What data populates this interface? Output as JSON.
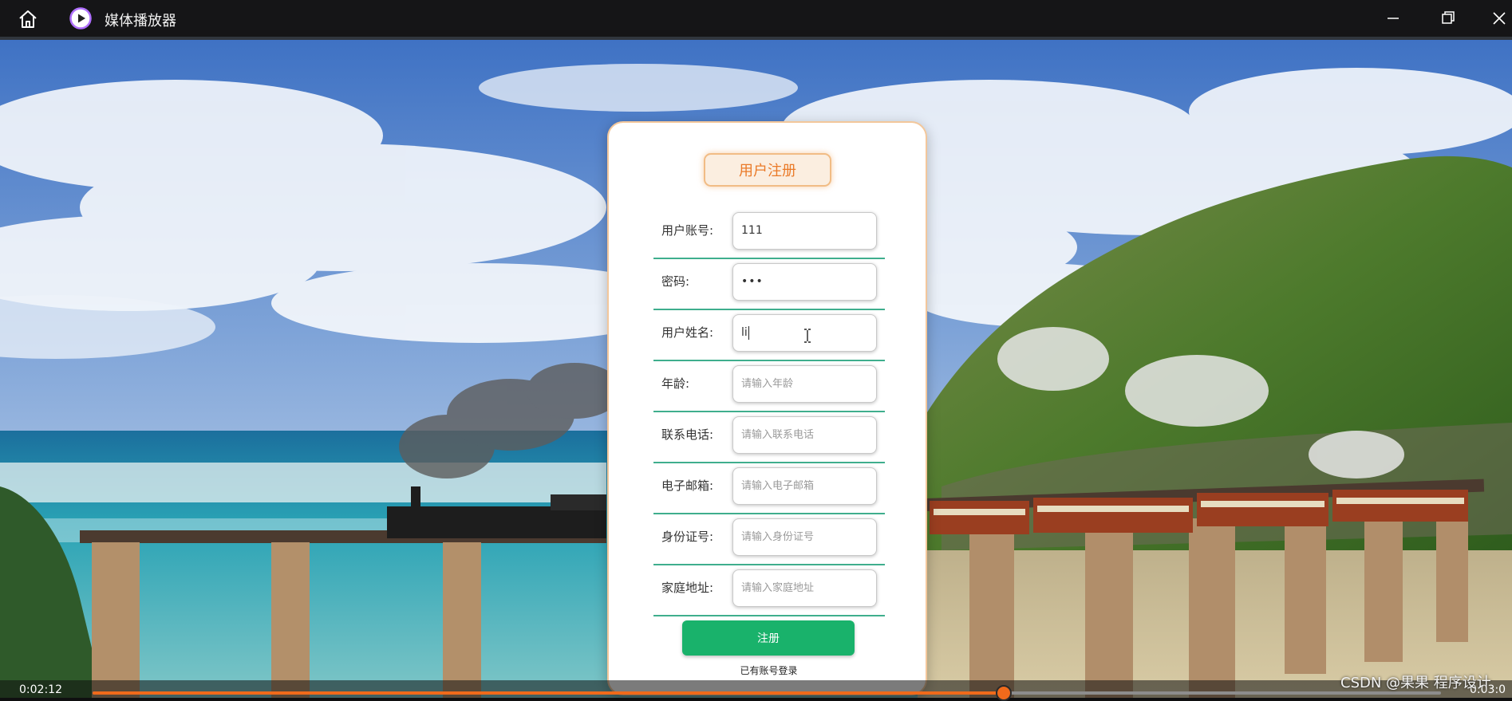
{
  "window": {
    "title": "媒体播放器",
    "icons": [
      "home-icon",
      "play-circle-icon",
      "minimize-icon",
      "restore-icon",
      "close-icon"
    ]
  },
  "form": {
    "title": "用户注册",
    "fields": [
      {
        "label": "用户账号:",
        "value": "111",
        "placeholder": ""
      },
      {
        "label": "密码:",
        "value": "•••",
        "placeholder": ""
      },
      {
        "label": "用户姓名:",
        "value": "li",
        "placeholder": ""
      },
      {
        "label": "年龄:",
        "value": "",
        "placeholder": "请输入年龄"
      },
      {
        "label": "联系电话:",
        "value": "",
        "placeholder": "请输入联系电话"
      },
      {
        "label": "电子邮箱:",
        "value": "",
        "placeholder": "请输入电子邮箱"
      },
      {
        "label": "身份证号:",
        "value": "",
        "placeholder": "请输入身份证号"
      },
      {
        "label": "家庭地址:",
        "value": "",
        "placeholder": "请输入家庭地址"
      }
    ],
    "submit_label": "注册",
    "login_link": "已有账号登录"
  },
  "player": {
    "elapsed": "0:02:12",
    "total": "0:03:0",
    "progress": 0.676
  },
  "watermark": "CSDN @果果 程序设计",
  "colors": {
    "accent": "#f06a1b",
    "submit": "#19b26b",
    "title_text": "#ea7a28",
    "row_line": "#3fae8d"
  }
}
